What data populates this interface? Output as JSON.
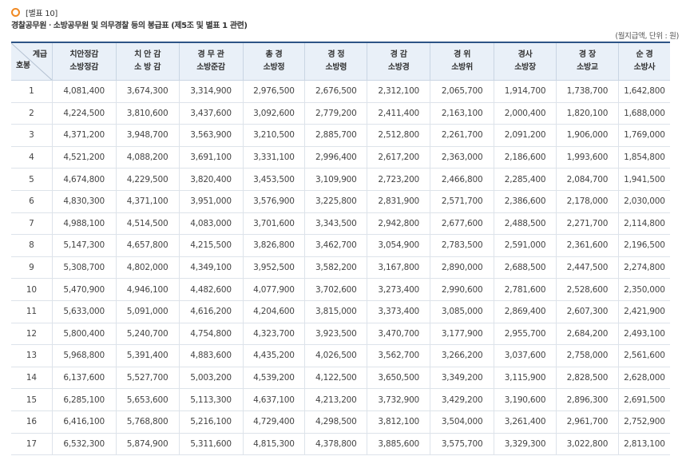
{
  "header": {
    "annex_label": "[별표 10]",
    "subtitle": "경찰공무원ㆍ소방공무원 및 의무경찰 등의 봉급표 (제5조 및 별표 1 관련)",
    "unit_note": "(월지급액, 단위 : 원)"
  },
  "table": {
    "corner_top": "계급",
    "corner_bottom": "호봉",
    "columns": [
      [
        "치안정감",
        "소방정감"
      ],
      [
        "치 안 감",
        "소 방 감"
      ],
      [
        "경 무 관",
        "소방준감"
      ],
      [
        "총 경",
        "소방정"
      ],
      [
        "경 정",
        "소방령"
      ],
      [
        "경 감",
        "소방경"
      ],
      [
        "경 위",
        "소방위"
      ],
      [
        "경사",
        "소방장"
      ],
      [
        "경 장",
        "소방교"
      ],
      [
        "순 경",
        "소방사"
      ]
    ],
    "rows": [
      [
        "1",
        "4,081,400",
        "3,674,300",
        "3,314,900",
        "2,976,500",
        "2,676,500",
        "2,312,100",
        "2,065,700",
        "1,914,700",
        "1,738,700",
        "1,642,800"
      ],
      [
        "2",
        "4,224,500",
        "3,810,600",
        "3,437,600",
        "3,092,600",
        "2,779,200",
        "2,411,400",
        "2,163,100",
        "2,000,400",
        "1,820,100",
        "1,688,000"
      ],
      [
        "3",
        "4,371,200",
        "3,948,700",
        "3,563,900",
        "3,210,500",
        "2,885,700",
        "2,512,800",
        "2,261,700",
        "2,091,200",
        "1,906,000",
        "1,769,000"
      ],
      [
        "4",
        "4,521,200",
        "4,088,200",
        "3,691,100",
        "3,331,100",
        "2,996,400",
        "2,617,200",
        "2,363,000",
        "2,186,600",
        "1,993,600",
        "1,854,800"
      ],
      [
        "5",
        "4,674,800",
        "4,229,500",
        "3,820,400",
        "3,453,500",
        "3,109,900",
        "2,723,200",
        "2,466,800",
        "2,285,400",
        "2,084,700",
        "1,941,500"
      ],
      [
        "6",
        "4,830,300",
        "4,371,100",
        "3,951,000",
        "3,576,900",
        "3,225,800",
        "2,831,900",
        "2,571,700",
        "2,386,600",
        "2,178,000",
        "2,030,000"
      ],
      [
        "7",
        "4,988,100",
        "4,514,500",
        "4,083,000",
        "3,701,600",
        "3,343,500",
        "2,942,800",
        "2,677,600",
        "2,488,500",
        "2,271,700",
        "2,114,800"
      ],
      [
        "8",
        "5,147,300",
        "4,657,800",
        "4,215,500",
        "3,826,800",
        "3,462,700",
        "3,054,900",
        "2,783,500",
        "2,591,000",
        "2,361,600",
        "2,196,500"
      ],
      [
        "9",
        "5,308,700",
        "4,802,000",
        "4,349,100",
        "3,952,500",
        "3,582,200",
        "3,167,800",
        "2,890,000",
        "2,688,500",
        "2,447,500",
        "2,274,800"
      ],
      [
        "10",
        "5,470,900",
        "4,946,100",
        "4,482,600",
        "4,077,900",
        "3,702,600",
        "3,273,400",
        "2,990,600",
        "2,781,600",
        "2,528,600",
        "2,350,000"
      ],
      [
        "11",
        "5,633,000",
        "5,091,000",
        "4,616,200",
        "4,204,600",
        "3,815,000",
        "3,373,400",
        "3,085,000",
        "2,869,400",
        "2,607,300",
        "2,421,900"
      ],
      [
        "12",
        "5,800,400",
        "5,240,700",
        "4,754,800",
        "4,323,700",
        "3,923,500",
        "3,470,700",
        "3,177,900",
        "2,955,700",
        "2,684,200",
        "2,493,100"
      ],
      [
        "13",
        "5,968,800",
        "5,391,400",
        "4,883,600",
        "4,435,200",
        "4,026,500",
        "3,562,700",
        "3,266,200",
        "3,037,600",
        "2,758,000",
        "2,561,600"
      ],
      [
        "14",
        "6,137,600",
        "5,527,700",
        "5,003,200",
        "4,539,200",
        "4,122,500",
        "3,650,500",
        "3,349,200",
        "3,115,900",
        "2,828,500",
        "2,628,000"
      ],
      [
        "15",
        "6,285,100",
        "5,653,600",
        "5,113,300",
        "4,637,100",
        "4,213,200",
        "3,732,900",
        "3,429,200",
        "3,190,600",
        "2,896,300",
        "2,691,500"
      ],
      [
        "16",
        "6,416,100",
        "5,768,800",
        "5,216,100",
        "4,729,400",
        "4,298,500",
        "3,812,100",
        "3,504,000",
        "3,261,400",
        "2,961,700",
        "2,752,900"
      ],
      [
        "17",
        "6,532,300",
        "5,874,900",
        "5,311,600",
        "4,815,300",
        "4,378,800",
        "3,885,600",
        "3,575,700",
        "3,329,300",
        "3,022,800",
        "2,813,100"
      ]
    ]
  }
}
